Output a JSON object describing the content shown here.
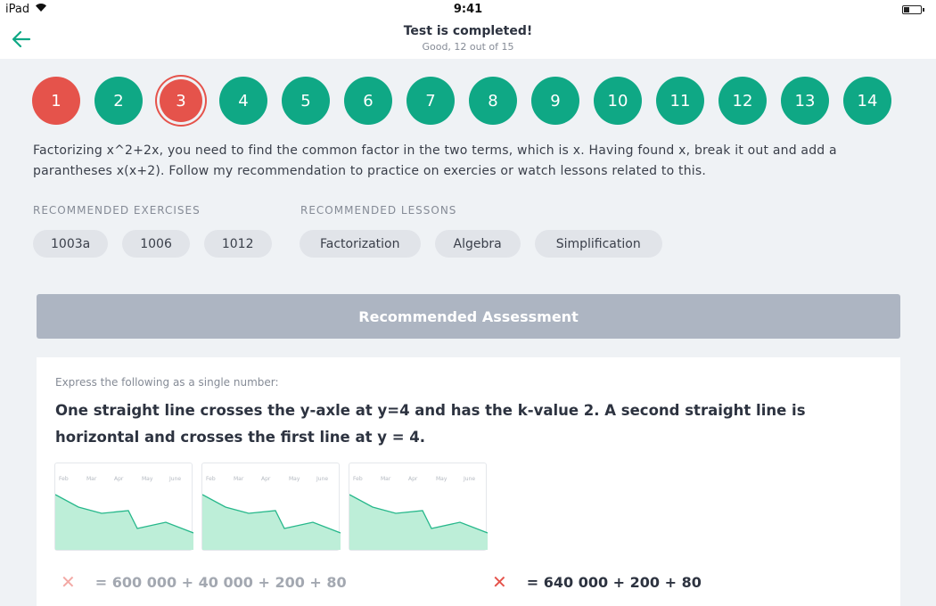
{
  "status": {
    "device": "iPad",
    "time": "9:41"
  },
  "header": {
    "title": "Test is completed!",
    "subtitle": "Good, 12 out of 15"
  },
  "questions": [
    {
      "label": "1",
      "state": "wrong"
    },
    {
      "label": "2",
      "state": "correct"
    },
    {
      "label": "3",
      "state": "wrong-selected"
    },
    {
      "label": "4",
      "state": "correct"
    },
    {
      "label": "5",
      "state": "correct"
    },
    {
      "label": "6",
      "state": "correct"
    },
    {
      "label": "7",
      "state": "correct"
    },
    {
      "label": "8",
      "state": "correct"
    },
    {
      "label": "9",
      "state": "correct"
    },
    {
      "label": "10",
      "state": "correct"
    },
    {
      "label": "11",
      "state": "correct"
    },
    {
      "label": "12",
      "state": "correct"
    },
    {
      "label": "13",
      "state": "correct"
    },
    {
      "label": "14",
      "state": "correct"
    }
  ],
  "explanation": "Factorizing x^2+2x, you need to find the common factor in the two terms, which is x. Having found x, break it out and add a parantheses x(x+2). Follow my recommendation to practice on exercies or watch lessons related to this.",
  "exercises": {
    "label": "RECOMMENDED EXERCISES",
    "items": [
      "1003a",
      "1006",
      "1012"
    ]
  },
  "lessons": {
    "label": "RECOMMENDED LESSONS",
    "items": [
      "Factorization",
      "Algebra",
      "Simplification"
    ]
  },
  "assessment": {
    "button_label": "Recommended Assessment",
    "instruction": "Express the following as a single number:",
    "question": "One straight line crosses the y-axle at y=4 and has the k-value 2. A second straight line is horizontal and crosses the first line at y = 4.",
    "thumbnails": [
      {
        "months": [
          "Feb",
          "Mar",
          "Apr",
          "May",
          "June"
        ],
        "values": [
          62,
          48,
          41,
          44,
          24,
          31,
          19
        ]
      },
      {
        "months": [
          "Feb",
          "Mar",
          "Apr",
          "May",
          "June"
        ],
        "values": [
          62,
          48,
          41,
          44,
          24,
          31,
          19
        ]
      },
      {
        "months": [
          "Feb",
          "Mar",
          "Apr",
          "May",
          "June"
        ],
        "values": [
          62,
          48,
          41,
          44,
          24,
          31,
          19
        ]
      }
    ],
    "answers": [
      {
        "text": "= 600 000 + 40 000 + 200 + 80",
        "muted": true
      },
      {
        "text": "= 640 000 + 200 + 80",
        "muted": false
      }
    ]
  },
  "colors": {
    "accent": "#0fa885",
    "wrong": "#e5534b",
    "wrong_light": "#f3a9a5",
    "chart_fill": "#bdeed8",
    "chart_line": "#27b88b"
  }
}
